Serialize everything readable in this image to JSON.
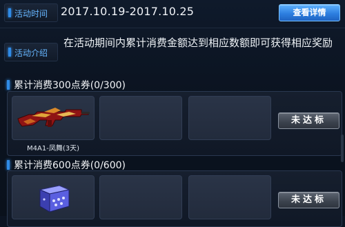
{
  "activity": {
    "time_label": "活动时间",
    "time_value": "2017.10.19-2017.10.25",
    "detail_button": "查看详情",
    "intro_label": "活动介绍",
    "intro_text": "在活动期间内累计消费金额达到相应数额即可获得相应奖励"
  },
  "tiers": [
    {
      "title": "累计消费300点券(0/300)",
      "items": [
        {
          "name": "M4A1-凤舞(3天)",
          "icon": "rifle-icon"
        }
      ],
      "status": "未达标"
    },
    {
      "title": "累计消费600点券(0/600)",
      "items": [
        {
          "name": "",
          "icon": "gift-box-icon"
        }
      ],
      "status": "未达标"
    }
  ],
  "colors": {
    "accent": "#2f8be6",
    "label_blue": "#66b6ff",
    "button_blue": "#2d7fe0",
    "status_gray": "#3b424d"
  }
}
